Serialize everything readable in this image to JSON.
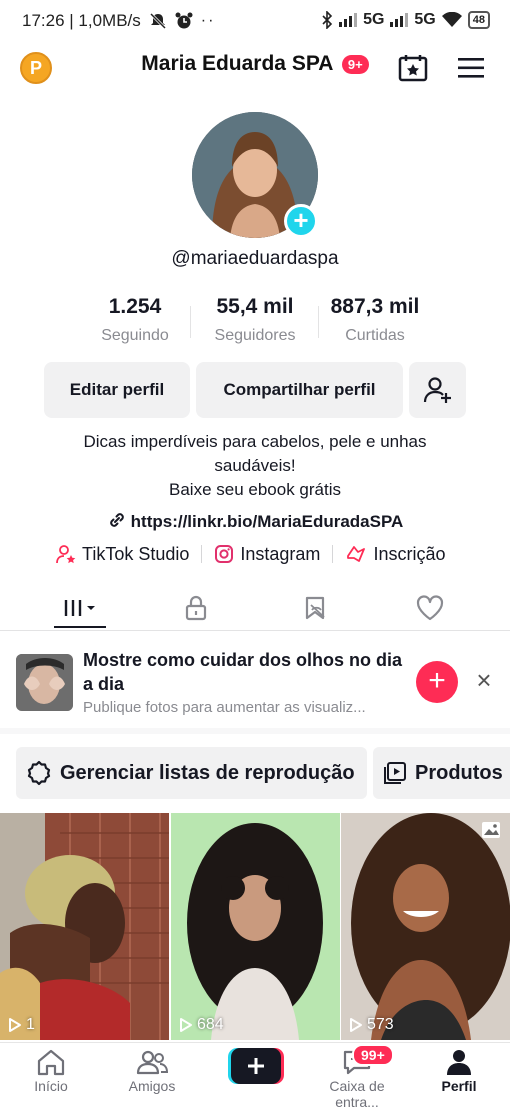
{
  "status_bar": {
    "time_speed": "17:26 | 1,0MB/s",
    "network1": "5G",
    "network2": "5G",
    "battery": "48"
  },
  "header": {
    "coin_letter": "P",
    "title": "Maria Eduarda SPA",
    "notif_badge": "9+"
  },
  "profile": {
    "username": "@mariaeduardaspa",
    "stats": [
      {
        "value": "1.254",
        "label": "Seguindo"
      },
      {
        "value": "55,4 mil",
        "label": "Seguidores"
      },
      {
        "value": "887,3 mil",
        "label": "Curtidas"
      }
    ],
    "edit_label": "Editar perfil",
    "share_label": "Compartilhar perfil",
    "bio_line1": "Dicas imperdíveis para cabelos, pele e unhas",
    "bio_line2": "saudáveis!",
    "bio_line3": "Baixe seu ebook grátis",
    "link": "https://linkr.bio/MariaEduradaSPA",
    "chips": [
      "TikTok Studio",
      "Instagram",
      "Inscrição"
    ]
  },
  "suggestion": {
    "title": "Mostre como cuidar dos olhos no dia a dia",
    "subtitle": "Publique fotos para aumentar as visualiz..."
  },
  "pills": {
    "playlists": "Gerenciar listas de reprodução",
    "products": "Produtos"
  },
  "videos": [
    {
      "views": "1"
    },
    {
      "views": "684"
    },
    {
      "views": "573"
    }
  ],
  "nav": {
    "home": "Início",
    "friends": "Amigos",
    "inbox": "Caixa de entra...",
    "inbox_badge": "99+",
    "profile": "Perfil"
  },
  "colors": {
    "accent": "#fe2c55",
    "cyan": "#20d5ec",
    "text": "#161823",
    "muted": "#8a8b91"
  }
}
